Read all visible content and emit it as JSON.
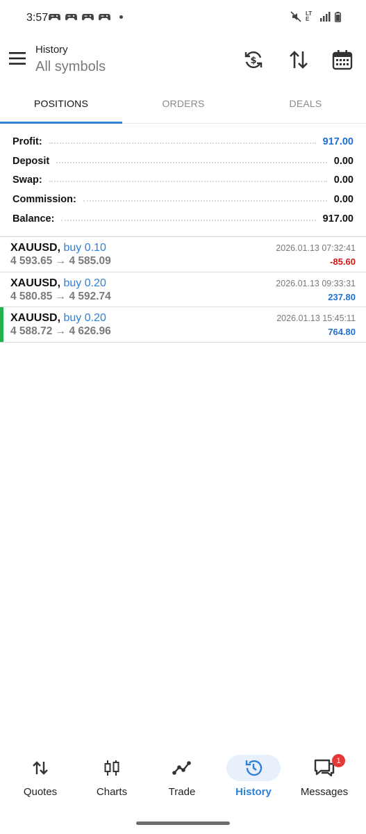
{
  "status_bar": {
    "time": "3:57",
    "notification_icons": [
      "game-controller-icon",
      "game-controller-icon",
      "game-controller-icon",
      "game-controller-icon"
    ],
    "right_icons": [
      "mute-icon",
      "lte-icon",
      "signal-icon",
      "battery-icon"
    ],
    "lte_label": "LTE"
  },
  "header": {
    "title": "History",
    "subtitle": "All symbols",
    "icons": [
      "currency-refresh-icon",
      "sort-icon",
      "calendar-icon"
    ]
  },
  "tabs": [
    {
      "label": "POSITIONS",
      "active": true
    },
    {
      "label": "ORDERS",
      "active": false
    },
    {
      "label": "DEALS",
      "active": false
    }
  ],
  "summary": [
    {
      "label": "Profit:",
      "value": "917.00"
    },
    {
      "label": "Deposit",
      "value": "0.00"
    },
    {
      "label": "Swap:",
      "value": "0.00"
    },
    {
      "label": "Commission:",
      "value": "0.00"
    },
    {
      "label": "Balance:",
      "value": "917.00"
    }
  ],
  "deals": [
    {
      "symbol": "XAUUSD,",
      "type": "buy 0.10",
      "prices": "4 593.65 → 4 585.09",
      "time": "2026.01.13 07:32:41",
      "profit": "-85.60",
      "highlight": false
    },
    {
      "symbol": "XAUUSD,",
      "type": "buy 0.20",
      "prices": "4 580.85 → 4 592.74",
      "time": "2026.01.13 09:33:31",
      "profit": "237.80",
      "highlight": false
    },
    {
      "symbol": "XAUUSD,",
      "type": "buy 0.20",
      "prices": "4 588.72 → 4 626.96",
      "time": "2026.01.13 15:45:11",
      "profit": "764.80",
      "highlight": true
    }
  ],
  "bottom_nav": [
    {
      "label": "Quotes",
      "icon": "up-down-arrows-icon",
      "active": false
    },
    {
      "label": "Charts",
      "icon": "candlestick-icon",
      "active": false
    },
    {
      "label": "Trade",
      "icon": "trend-line-icon",
      "active": false
    },
    {
      "label": "History",
      "icon": "history-clock-icon",
      "active": true
    },
    {
      "label": "Messages",
      "icon": "chat-icon",
      "active": false,
      "badge": "1"
    }
  ],
  "colors": {
    "accent": "#2f80d7",
    "profit_positive": "#1f6fd1",
    "profit_negative": "#d31616",
    "highlight_bar": "#22b14c"
  }
}
